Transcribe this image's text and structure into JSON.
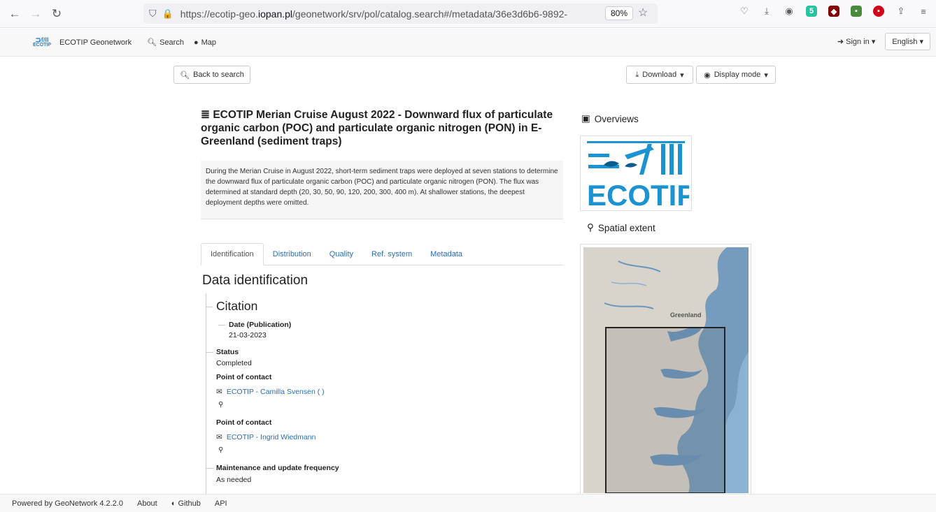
{
  "browser": {
    "url_prefix": "https://ecotip-geo.",
    "url_domain": "iopan.pl",
    "url_suffix": "/geonetwork/srv/pol/catalog.search#/metadata/36e3d6b6-9892-",
    "zoom": "80%",
    "ext_badge_count": "5"
  },
  "nav": {
    "brand": "ECOTIP Geonetwork",
    "search": "Search",
    "map": "Map",
    "sign_in": "Sign in",
    "language": "English"
  },
  "toolbar": {
    "back": "Back to search",
    "download": "Download",
    "display_mode": "Display mode"
  },
  "record": {
    "title": "ECOTIP Merian Cruise August 2022 - Downward flux of particulate organic carbon (POC) and particulate organic nitrogen (PON) in E-Greenland (sediment traps)",
    "abstract": "During the Merian Cruise in August 2022, short-term sediment traps were deployed at seven stations to determine the downward flux of particulate organic carbon (POC) and particulate organic nitrogen (PON). The flux was determined at standard depth (20, 30, 50, 90, 120, 200, 300, 400 m). At shallower stations, the deepest deployment depths were omitted."
  },
  "tabs": [
    "Identification",
    "Distribution",
    "Quality",
    "Ref. system",
    "Metadata"
  ],
  "identification": {
    "heading": "Data identification",
    "citation_heading": "Citation",
    "date_label": "Date (Publication)",
    "date_value": "21-03-2023",
    "status_label": "Status",
    "status_value": "Completed",
    "poc_label_1": "Point of contact",
    "poc_name_1": "ECOTIP - Camilla Svensen ( )",
    "poc_label_2": "Point of contact",
    "poc_name_2": "ECOTIP - Ingrid Wiedmann",
    "maint_label": "Maintenance and update frequency",
    "maint_value": "As needed"
  },
  "side": {
    "overviews": "Overviews",
    "spatial_extent": "Spatial extent",
    "logo_text": "ECOTIP",
    "map_label": "Greenland"
  },
  "footer": {
    "powered": "Powered by GeoNetwork 4.2.2.0",
    "about": "About",
    "github": "Github",
    "api": "API"
  }
}
